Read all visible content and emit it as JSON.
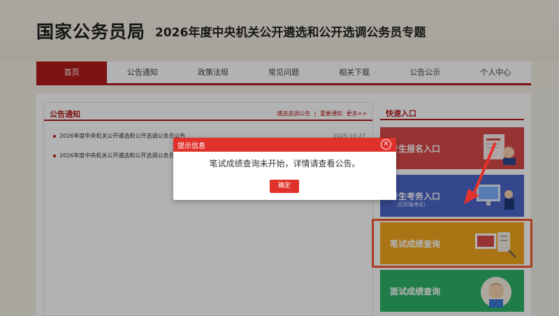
{
  "header": {
    "logo": "国家公务员局",
    "title": "2026年度中央机关公开遴选和公开选调公务员专题"
  },
  "nav": {
    "items": [
      "首页",
      "公告通知",
      "政策法规",
      "常见问题",
      "相关下载",
      "公告公示",
      "个人中心"
    ],
    "active_index": 0
  },
  "notices": {
    "title": "公告通知",
    "links": [
      "遴选选调公告",
      "|",
      "重要通知",
      "更多>>"
    ],
    "items": [
      {
        "text": "2026年度中央机关公开遴选和公开选调公务员公告",
        "date": "2025-10-27"
      },
      {
        "text": "2026年度中央机关公开遴选和公开选调公务员",
        "date": ""
      }
    ]
  },
  "quick": {
    "title": "快速入口",
    "cards": [
      {
        "label": "考生报名入口",
        "sub": "",
        "color": "#d84a4a"
      },
      {
        "label": "考生考务入口",
        "sub": "（打印准考证）",
        "color": "#4b66c9"
      },
      {
        "label": "笔试成绩查询",
        "sub": "",
        "color": "#f2a81d"
      },
      {
        "label": "面试成绩查询",
        "sub": "",
        "color": "#2fb36b"
      }
    ]
  },
  "dialog": {
    "title": "提示信息",
    "message": "笔试成绩查询未开始，详情请查看公告。",
    "ok_label": "确定",
    "close_icon": "close-icon"
  },
  "colors": {
    "brand_red": "#b41a1a",
    "dialog_red": "#e0312b",
    "highlight": "#f15a2a"
  }
}
